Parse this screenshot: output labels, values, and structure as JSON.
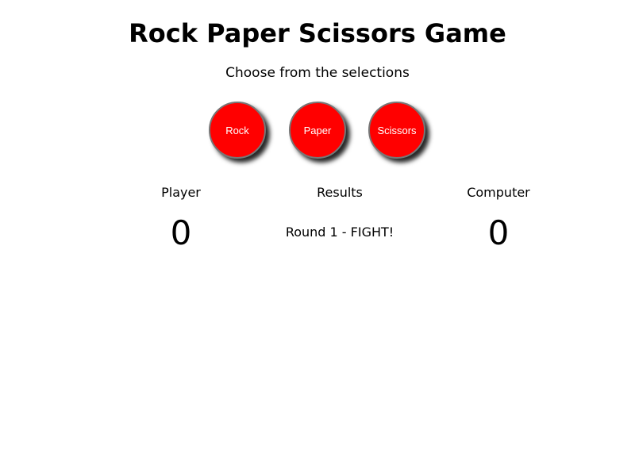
{
  "title": "Rock Paper Scissors Game",
  "subtitle": "Choose from the selections",
  "choices": [
    {
      "label": "Rock"
    },
    {
      "label": "Paper"
    },
    {
      "label": "Scissors"
    }
  ],
  "scoreboard": {
    "player_label": "Player",
    "results_label": "Results",
    "computer_label": "Computer",
    "player_score": "0",
    "computer_score": "0",
    "result_text": "Round 1 - FIGHT!"
  },
  "colors": {
    "button_fill": "#ff0000",
    "button_text": "#ffffff"
  }
}
